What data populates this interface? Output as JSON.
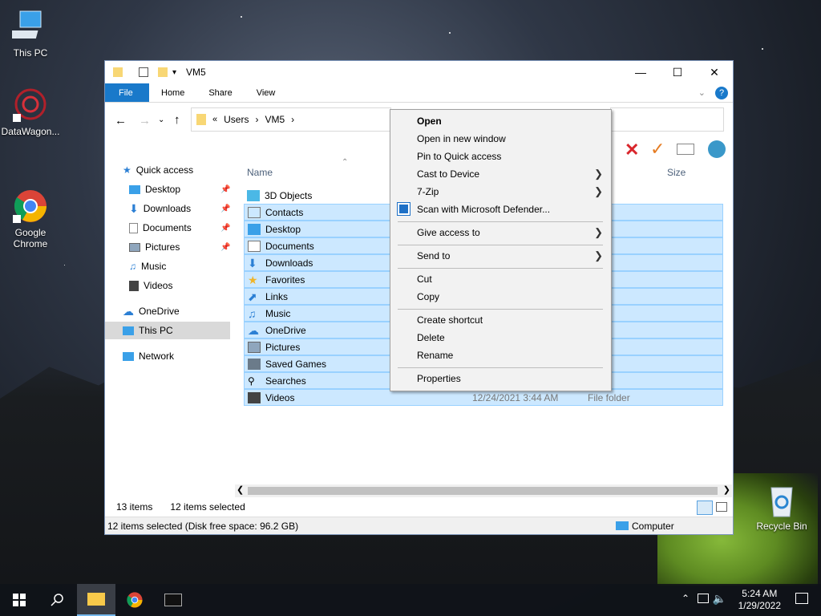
{
  "desktop": {
    "icons": [
      {
        "label": "This PC",
        "icon": "computer-icon"
      },
      {
        "label": "DataWagon...",
        "icon": "datawagon-icon"
      },
      {
        "label": "Google\nChrome",
        "icon": "chrome-icon"
      },
      {
        "label": "Recycle Bin",
        "icon": "recycle-bin-icon"
      }
    ]
  },
  "window": {
    "title": "VM5",
    "ribbon_tabs": [
      "File",
      "Home",
      "Share",
      "View"
    ],
    "address": {
      "root": "«",
      "crumbs": [
        "Users",
        "VM5"
      ]
    },
    "nav": {
      "items": [
        {
          "label": "Quick access",
          "pinned": false
        },
        {
          "label": "Desktop",
          "pinned": true
        },
        {
          "label": "Downloads",
          "pinned": true
        },
        {
          "label": "Documents",
          "pinned": true
        },
        {
          "label": "Pictures",
          "pinned": true
        },
        {
          "label": "Music",
          "pinned": false
        },
        {
          "label": "Videos",
          "pinned": false
        },
        {
          "label": "OneDrive",
          "pinned": false
        },
        {
          "label": "This PC",
          "pinned": false,
          "selected": true
        },
        {
          "label": "Network",
          "pinned": false
        }
      ]
    },
    "columns": {
      "name": "Name",
      "size": "Size"
    },
    "files": [
      {
        "name": "3D Objects",
        "selected": false
      },
      {
        "name": "Contacts",
        "selected": true
      },
      {
        "name": "Desktop",
        "selected": true
      },
      {
        "name": "Documents",
        "selected": true
      },
      {
        "name": "Downloads",
        "selected": true
      },
      {
        "name": "Favorites",
        "selected": true
      },
      {
        "name": "Links",
        "selected": true
      },
      {
        "name": "Music",
        "selected": true
      },
      {
        "name": "OneDrive",
        "selected": true
      },
      {
        "name": "Pictures",
        "selected": true
      },
      {
        "name": "Saved Games",
        "selected": true
      },
      {
        "name": "Searches",
        "selected": true
      },
      {
        "name": "Videos",
        "selected": true,
        "date": "12/24/2021 3:44 AM",
        "type": "File folder"
      }
    ],
    "status": {
      "items_count": "13 items",
      "selected_count": "12 items selected",
      "selection_detail": "12 items selected (Disk free space: 96.2 GB)",
      "location": "Computer"
    }
  },
  "context_menu": {
    "items": [
      {
        "label": "Open",
        "bold": true
      },
      {
        "label": "Open in new window"
      },
      {
        "label": "Pin to Quick access"
      },
      {
        "label": "Cast to Device",
        "submenu": true
      },
      {
        "label": "7-Zip",
        "submenu": true
      },
      {
        "label": "Scan with Microsoft Defender...",
        "icon": "defender-icon"
      },
      {
        "label": "Give access to",
        "submenu": true
      },
      {
        "label": "Send to",
        "submenu": true
      },
      {
        "label": "Cut"
      },
      {
        "label": "Copy"
      },
      {
        "label": "Create shortcut"
      },
      {
        "label": "Delete"
      },
      {
        "label": "Rename"
      },
      {
        "label": "Properties"
      }
    ]
  },
  "taskbar": {
    "time": "5:24 AM",
    "date": "1/29/2022"
  },
  "colors": {
    "accent": "#1979ca",
    "selection": "#cce8ff"
  }
}
